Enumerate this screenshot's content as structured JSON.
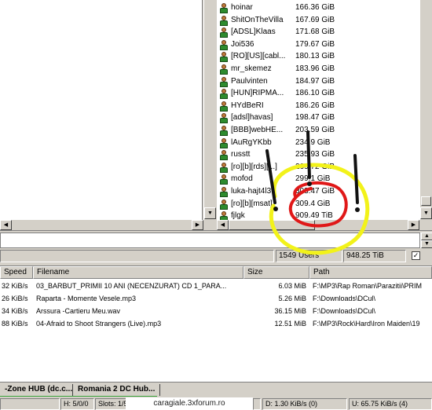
{
  "users": [
    {
      "nick": "hoinar",
      "share": "166.36 GiB"
    },
    {
      "nick": "ShitOnTheVilla",
      "share": "167.69 GiB"
    },
    {
      "nick": "[ADSL]Klaas",
      "share": "171.68 GiB"
    },
    {
      "nick": "Joi536",
      "share": "179.67 GiB"
    },
    {
      "nick": "[RO][US][cabl...",
      "share": "180.13 GiB"
    },
    {
      "nick": "mr_skemez",
      "share": "183.96 GiB"
    },
    {
      "nick": "Paulvinten",
      "share": "184.97 GiB"
    },
    {
      "nick": "[HUN]RIPMA...",
      "share": "186.10 GiB"
    },
    {
      "nick": "HYdBeRI",
      "share": "186.26 GiB"
    },
    {
      "nick": "[adsl]havas]",
      "share": "198.47 GiB"
    },
    {
      "nick": "[BBB]webHE...",
      "share": "203.59 GiB"
    },
    {
      "nick": "lAuRgYKbb",
      "share": "234.9 GiB"
    },
    {
      "nick": "russtt",
      "share": "235.93 GiB"
    },
    {
      "nick": "[ro][b][rds][...]",
      "share": "269.72 GiB"
    },
    {
      "nick": "mofod",
      "share": "299.1 GiB"
    },
    {
      "nick": "luka-hajt4l3",
      "share": "303.47 GiB"
    },
    {
      "nick": "[ro][b][msat]",
      "share": "309.4 GiB"
    },
    {
      "nick": "fjlgk",
      "share": "909.49 TiB"
    }
  ],
  "hub_status": {
    "users": "1549 Users",
    "total_share": "948.25 TiB",
    "checkbox_mark": "✓"
  },
  "transfers": {
    "columns": {
      "speed": "Speed",
      "filename": "Filename",
      "size": "Size",
      "path": "Path"
    },
    "rows": [
      {
        "speed": "32 KiB/s",
        "filename": "03_BARBUT_PRIMII 10 ANI (NECENZURAT) CD 1_PARA...",
        "size": "6.03 MiB",
        "path": "F:\\MP3\\Rap Roman\\Parazitii\\PRIM"
      },
      {
        "speed": "26 KiB/s",
        "filename": "Raparta - Momente Vesele.mp3",
        "size": "5.26 MiB",
        "path": "F:\\Downloads\\DCul\\"
      },
      {
        "speed": "34 KiB/s",
        "filename": "Arssura -Cartieru Meu.wav",
        "size": "36.15 MiB",
        "path": "F:\\Downloads\\DCul\\"
      },
      {
        "speed": "88 KiB/s",
        "filename": "04-Afraid to Shoot Strangers (Live).mp3",
        "size": "12.51 MiB",
        "path": "F:\\MP3\\Rock\\Hard\\Iron Maiden\\19"
      }
    ]
  },
  "tabs": [
    {
      "label": "-Zone HUB (dc.c..."
    },
    {
      "label": "Romania 2 DC Hub..."
    }
  ],
  "statusbar": {
    "hubs": "H: 5/0/0",
    "slots": "Slots: 1/5",
    "watermark": "caragiale.3xforum.ro",
    "download": "D: 1.30 KiB/s (0)",
    "upload": "U: 65.75 KiB/s (4)"
  },
  "colors": {
    "annotation_yellow": "#f2f21a",
    "annotation_red": "#e01818",
    "annotation_black": "#111111",
    "tab_underline": "#3aa33a"
  }
}
